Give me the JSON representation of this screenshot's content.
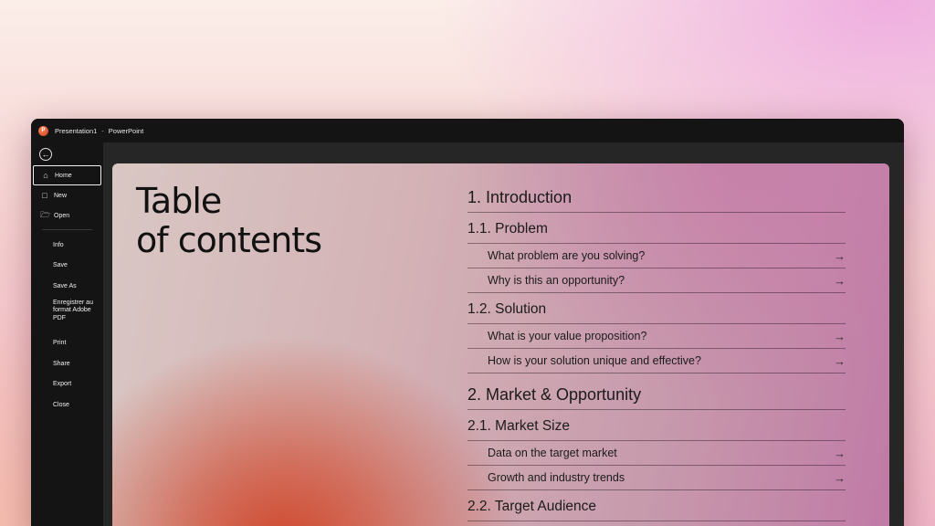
{
  "window": {
    "app_icon": "powerpoint-logo-icon",
    "document": "Presentation1",
    "separator": "-",
    "app_name": "PowerPoint"
  },
  "sidebar": {
    "back_icon": "back-arrow-icon",
    "primary": [
      {
        "label": "Home",
        "icon": "home-icon",
        "active": true
      },
      {
        "label": "New",
        "icon": "new-document-icon"
      },
      {
        "label": "Open",
        "icon": "folder-open-icon"
      }
    ],
    "secondary": [
      {
        "label": "Info"
      },
      {
        "label": "Save"
      },
      {
        "label": "Save As"
      },
      {
        "label": "Enregistrer au format Adobe PDF"
      },
      {
        "label": "Print"
      },
      {
        "label": "Share"
      },
      {
        "label": "Export"
      },
      {
        "label": "Close"
      }
    ]
  },
  "slide": {
    "title_line1": "Table",
    "title_line2": "of contents",
    "toc": [
      {
        "level": 1,
        "text": "1. Introduction"
      },
      {
        "level": 2,
        "text": "1.1. Problem"
      },
      {
        "level": 3,
        "text": "What problem are you solving?",
        "arrow": "→"
      },
      {
        "level": 3,
        "text": "Why is this an opportunity?",
        "arrow": "→"
      },
      {
        "level": 2,
        "text": "1.2. Solution"
      },
      {
        "level": 3,
        "text": "What is your value proposition?",
        "arrow": "→"
      },
      {
        "level": 3,
        "text": "How is your solution unique and effective?",
        "arrow": "→"
      },
      {
        "level": 1,
        "text": "2. Market & Opportunity"
      },
      {
        "level": 2,
        "text": "2.1. Market Size"
      },
      {
        "level": 3,
        "text": "Data on the target market",
        "arrow": "→"
      },
      {
        "level": 3,
        "text": "Growth and industry trends",
        "arrow": "→"
      },
      {
        "level": 2,
        "text": "2.2. Target Audience"
      }
    ]
  },
  "colors": {
    "titlebar": "#141414",
    "sidebar": "#141414",
    "canvas": "#262626",
    "accent_orange": "#d0482c",
    "accent_pink": "#c07aa6"
  }
}
